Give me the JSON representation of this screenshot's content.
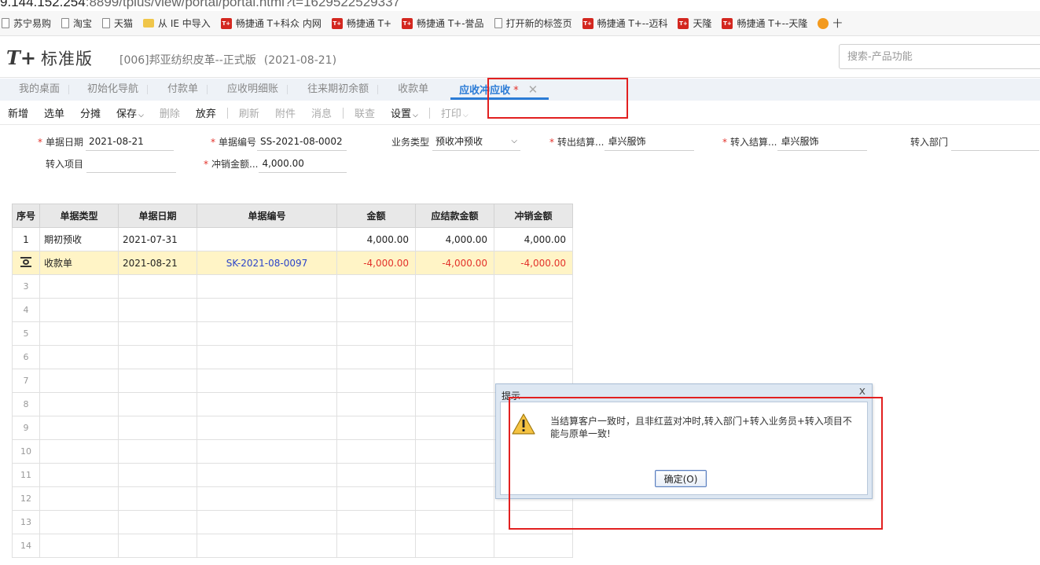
{
  "browser": {
    "url_host": "9.144.152.254",
    "url_rest": ":8899/tplus/view/portal/portal.html?t=1629522529337",
    "bookmarks": [
      {
        "label": "苏宁易购",
        "icon": "page-icon"
      },
      {
        "label": "淘宝",
        "icon": "page-icon"
      },
      {
        "label": "天猫",
        "icon": "page-icon"
      },
      {
        "label": "从 IE 中导入",
        "icon": "folder-icon"
      },
      {
        "label": "畅捷通 T+科众 内网",
        "icon": "tplus-icon"
      },
      {
        "label": "畅捷通 T+",
        "icon": "tplus-icon"
      },
      {
        "label": "畅捷通 T+-誉品",
        "icon": "tplus-icon"
      },
      {
        "label": "打开新的标签页",
        "icon": "page-icon"
      },
      {
        "label": "畅捷通 T+--迈科",
        "icon": "tplus-icon"
      },
      {
        "label": "天隆",
        "icon": "tplus-icon"
      },
      {
        "label": "畅捷通 T+--天隆",
        "icon": "tplus-icon"
      },
      {
        "label": "十",
        "icon": "orange-icon"
      }
    ]
  },
  "header": {
    "logo_mark": "T+",
    "logo_text": "标准版",
    "company": "[006]邦亚纺织皮革--正式版",
    "date": "(2021-08-21)",
    "search_placeholder": "搜索-产品功能"
  },
  "tabs": [
    {
      "label": "我的桌面"
    },
    {
      "label": "初始化导航"
    },
    {
      "label": "付款单"
    },
    {
      "label": "应收明细账"
    },
    {
      "label": "往来期初余额"
    },
    {
      "label": "收款单"
    }
  ],
  "active_tab": {
    "label": "应收冲应收",
    "modified": "*",
    "close": "✕"
  },
  "toolbar": {
    "new": "新增",
    "select": "选单",
    "allocate": "分摊",
    "save": "保存",
    "delete": "删除",
    "discard": "放弃",
    "refresh": "刷新",
    "attachment": "附件",
    "message": "消息",
    "link_query": "联查",
    "settings": "设置",
    "print": "打印"
  },
  "form": {
    "doc_date_label": "单据日期",
    "doc_date": "2021-08-21",
    "doc_no_label": "单据编号",
    "doc_no": "SS-2021-08-0002",
    "biz_type_label": "业务类型",
    "biz_type": "预收冲预收",
    "out_settle_label": "转出结算...",
    "out_settle": "卓兴服饰",
    "in_settle_label": "转入结算...",
    "in_settle": "卓兴服饰",
    "in_dept_label": "转入部门",
    "in_dept": "",
    "in_project_label": "转入项目",
    "in_project": "",
    "writeoff_amt_label": "冲销金额...",
    "writeoff_amt": "4,000.00"
  },
  "grid": {
    "headers": [
      "序号",
      "单据类型",
      "单据日期",
      "单据编号",
      "金额",
      "应结款金额",
      "冲销金额"
    ],
    "rows": [
      {
        "idx": "1",
        "type": "期初预收",
        "date": "2021-07-31",
        "no": "",
        "amount": "4,000.00",
        "due": "4,000.00",
        "writeoff": "4,000.00"
      },
      {
        "idx": "",
        "type": "收款单",
        "date": "2021-08-21",
        "no": "SK-2021-08-0097",
        "amount": "-4,000.00",
        "due": "-4,000.00",
        "writeoff": "-4,000.00"
      }
    ],
    "empty_rows": [
      "3",
      "4",
      "5",
      "6",
      "7",
      "8",
      "9",
      "10",
      "11",
      "12",
      "13",
      "14"
    ]
  },
  "dialog": {
    "title": "提示",
    "close": "x",
    "message": "当结算客户一致时，且非红蓝对冲时,转入部门+转入业务员+转入项目不能与原单一致!",
    "ok": "确定(O)"
  },
  "colors": {
    "accent": "#2b7bd6",
    "negative": "#e3322b",
    "selected_row": "#fff4c6",
    "annotation": "#e22020"
  }
}
